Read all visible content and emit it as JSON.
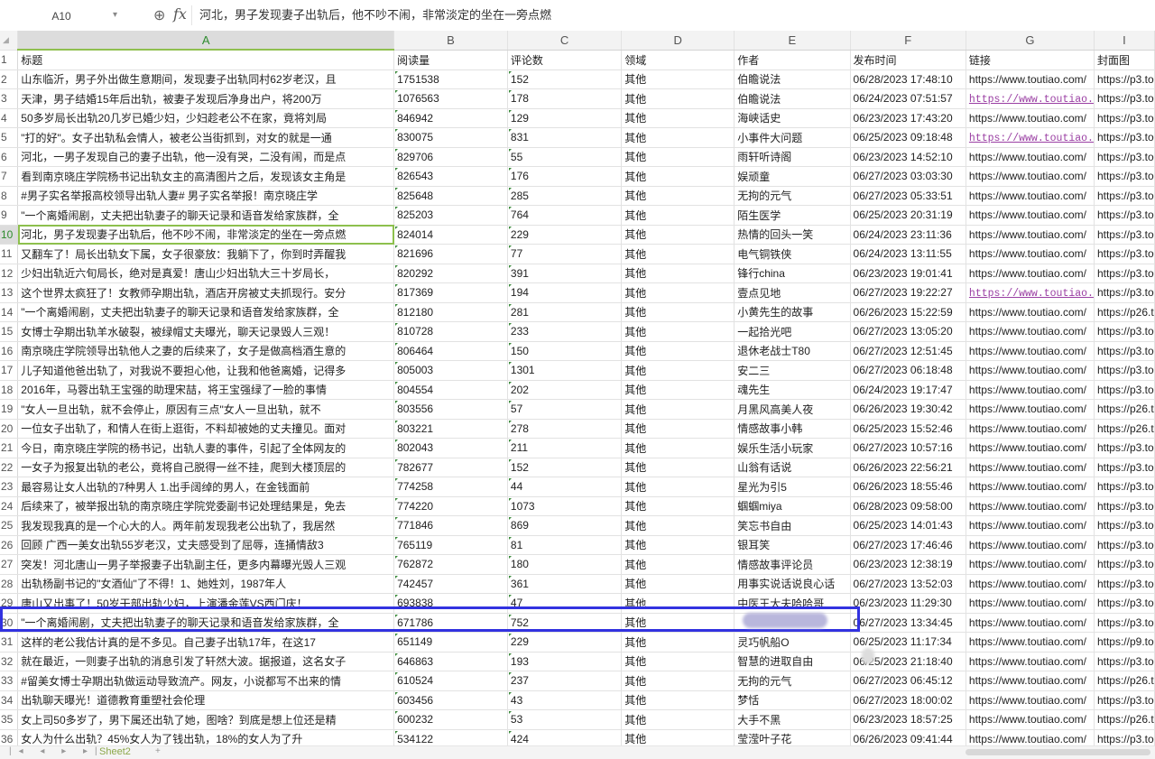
{
  "formula_bar": {
    "cell_ref": "A10",
    "fx_label": "fx",
    "content": "河北，男子发现妻子出轨后，他不吵不闹，非常淡定的坐在一旁点燃"
  },
  "columns": [
    "A",
    "B",
    "C",
    "D",
    "E",
    "F",
    "G",
    "I"
  ],
  "header_row": [
    "标题",
    "阅读量",
    "评论数",
    "领域",
    "作者",
    "发布时间",
    "链接",
    "封面图"
  ],
  "rows": [
    {
      "n": "2",
      "title": "山东临沂，男子外出做生意期间，发现妻子出轨同村62岁老汉，且",
      "reads": "1751538",
      "comments": "152",
      "domain": "其他",
      "author": "伯瞻说法",
      "time": "06/28/2023 17:48:10",
      "link": "https://www.toutiao.com/",
      "link_style": "plain",
      "cover": "https://p3.to"
    },
    {
      "n": "3",
      "title": "天津，男子结婚15年后出轨，被妻子发现后净身出户，将200万",
      "reads": "1076563",
      "comments": "178",
      "domain": "其他",
      "author": "伯瞻说法",
      "time": "06/24/2023 07:51:57",
      "link": "https://www.toutiao.",
      "link_style": "hyperlink",
      "cover": "https://p3.to"
    },
    {
      "n": "4",
      "title": "50多岁局长出轨20几岁已婚少妇，少妇趁老公不在家，竟将刘局",
      "reads": "846942",
      "comments": "129",
      "domain": "其他",
      "author": "海峡话史",
      "time": "06/23/2023 17:43:20",
      "link": "https://www.toutiao.com/",
      "link_style": "plain",
      "cover": "https://p3.to"
    },
    {
      "n": "5",
      "title": "\"打的好\"。女子出轨私会情人，被老公当街抓到，对女的就是一通",
      "reads": "830075",
      "comments": "831",
      "domain": "其他",
      "author": "小事件大问题",
      "time": "06/25/2023 09:18:48",
      "link": "https://www.toutiao.",
      "link_style": "hyperlink",
      "cover": "https://p3.to"
    },
    {
      "n": "6",
      "title": "河北，一男子发现自己的妻子出轨，他一没有哭，二没有闹，而是点",
      "reads": "829706",
      "comments": "55",
      "domain": "其他",
      "author": "雨轩听诗阁",
      "time": "06/23/2023 14:52:10",
      "link": "https://www.toutiao.com/",
      "link_style": "plain",
      "cover": "https://p3.to"
    },
    {
      "n": "7",
      "title": "看到南京晓庄学院杨书记出轨女主的高清图片之后，发现该女主角是",
      "reads": "826543",
      "comments": "176",
      "domain": "其他",
      "author": "娱顽童",
      "time": "06/27/2023 03:03:30",
      "link": "https://www.toutiao.com/",
      "link_style": "plain",
      "cover": "https://p3.to"
    },
    {
      "n": "8",
      "title": "#男子实名举报高校领导出轨人妻# 男子实名举报！南京晓庄学",
      "reads": "825648",
      "comments": "285",
      "domain": "其他",
      "author": "无拘的元气",
      "time": "06/27/2023 05:33:51",
      "link": "https://www.toutiao.com/",
      "link_style": "plain",
      "cover": "https://p3.to"
    },
    {
      "n": "9",
      "title": "\"一个离婚闹剧，丈夫把出轨妻子的聊天记录和语音发给家族群，全",
      "reads": "825203",
      "comments": "764",
      "domain": "其他",
      "author": "陌生医学",
      "time": "06/25/2023 20:31:19",
      "link": "https://www.toutiao.com/",
      "link_style": "plain",
      "cover": "https://p3.to"
    },
    {
      "n": "10",
      "title": "河北，男子发现妻子出轨后，他不吵不闹，非常淡定的坐在一旁点燃",
      "reads": "824014",
      "comments": "229",
      "domain": "其他",
      "author": "热情的回头一笑",
      "time": "06/24/2023 23:11:36",
      "link": "https://www.toutiao.com/",
      "link_style": "plain",
      "cover": "https://p3.to",
      "selected": true
    },
    {
      "n": "11",
      "title": "又翻车了！局长出轨女下属，女子很豪放：我躺下了，你到时弄醒我",
      "reads": "821696",
      "comments": "77",
      "domain": "其他",
      "author": "电气铜铁侠",
      "time": "06/24/2023 13:11:55",
      "link": "https://www.toutiao.com/",
      "link_style": "plain",
      "cover": "https://p3.to"
    },
    {
      "n": "12",
      "title": "少妇出轨近六旬局长，绝对是真爱！唐山少妇出轨大三十岁局长，",
      "reads": "820292",
      "comments": "391",
      "domain": "其他",
      "author": "锋行china",
      "time": "06/23/2023 19:01:41",
      "link": "https://www.toutiao.com/",
      "link_style": "plain",
      "cover": "https://p3.to"
    },
    {
      "n": "13",
      "title": "这个世界太疯狂了！女教师孕期出轨，酒店开房被丈夫抓现行。安分",
      "reads": "817369",
      "comments": "194",
      "domain": "其他",
      "author": "壹点见地",
      "time": "06/27/2023 19:22:27",
      "link": "https://www.toutiao.",
      "link_style": "hyperlink",
      "cover": "https://p3.to"
    },
    {
      "n": "14",
      "title": "\"一个离婚闹剧，丈夫把出轨妻子的聊天记录和语音发给家族群，全",
      "reads": "812180",
      "comments": "281",
      "domain": "其他",
      "author": "小黄先生的故事",
      "time": "06/26/2023 15:22:59",
      "link": "https://www.toutiao.com/",
      "link_style": "plain",
      "cover": "https://p26.t"
    },
    {
      "n": "15",
      "title": "女博士孕期出轨羊水破裂，被绿帽丈夫曝光，聊天记录毁人三观！",
      "reads": "810728",
      "comments": "233",
      "domain": "其他",
      "author": "一起拾光吧",
      "time": "06/27/2023 13:05:20",
      "link": "https://www.toutiao.com/",
      "link_style": "plain",
      "cover": "https://p3.to"
    },
    {
      "n": "16",
      "title": "南京晓庄学院领导出轨他人之妻的后续来了，女子是做高档酒生意的",
      "reads": "806464",
      "comments": "150",
      "domain": "其他",
      "author": "退休老战士T80",
      "time": "06/27/2023 12:51:45",
      "link": "https://www.toutiao.com/",
      "link_style": "plain",
      "cover": "https://p3.to"
    },
    {
      "n": "17",
      "title": "儿子知道他爸出轨了，对我说不要担心他，让我和他爸离婚，记得多",
      "reads": "805003",
      "comments": "1301",
      "domain": "其他",
      "author": "安二三",
      "time": "06/27/2023 06:18:48",
      "link": "https://www.toutiao.com/",
      "link_style": "plain",
      "cover": "https://p3.to"
    },
    {
      "n": "18",
      "title": "2016年，马蓉出轨王宝强的助理宋喆，将王宝强绿了一脸的事情",
      "reads": "804554",
      "comments": "202",
      "domain": "其他",
      "author": "魂先生",
      "time": "06/24/2023 19:17:47",
      "link": "https://www.toutiao.com/",
      "link_style": "plain",
      "cover": "https://p3.to"
    },
    {
      "n": "19",
      "title": "\"女人一旦出轨，就不会停止，原因有三点\"女人一旦出轨，就不",
      "reads": "803556",
      "comments": "57",
      "domain": "其他",
      "author": "月黑风高美人夜",
      "time": "06/26/2023 19:30:42",
      "link": "https://www.toutiao.com/",
      "link_style": "plain",
      "cover": "https://p26.t"
    },
    {
      "n": "20",
      "title": "一位女子出轨了，和情人在街上逛街，不料却被她的丈夫撞见。面对",
      "reads": "803221",
      "comments": "278",
      "domain": "其他",
      "author": "情感故事小韩",
      "time": "06/25/2023 15:52:46",
      "link": "https://www.toutiao.com/",
      "link_style": "plain",
      "cover": "https://p26.t"
    },
    {
      "n": "21",
      "title": "今日，南京晓庄学院的杨书记，出轨人妻的事件，引起了全体网友的",
      "reads": "802043",
      "comments": "211",
      "domain": "其他",
      "author": "娱乐生活小玩家",
      "time": "06/27/2023 10:57:16",
      "link": "https://www.toutiao.com/",
      "link_style": "plain",
      "cover": "https://p3.to"
    },
    {
      "n": "22",
      "title": "一女子为报复出轨的老公，竟将自己脱得一丝不挂，爬到大楼顶层的",
      "reads": "782677",
      "comments": "152",
      "domain": "其他",
      "author": "山翁有话说",
      "time": "06/26/2023 22:56:21",
      "link": "https://www.toutiao.com/",
      "link_style": "plain",
      "cover": "https://p3.to"
    },
    {
      "n": "23",
      "title": "最容易让女人出轨的7种男人 1.出手阔绰的男人，在金钱面前",
      "reads": "774258",
      "comments": "44",
      "domain": "其他",
      "author": "星光为引5",
      "time": "06/26/2023 18:55:46",
      "link": "https://www.toutiao.com/",
      "link_style": "plain",
      "cover": "https://p3.to"
    },
    {
      "n": "24",
      "title": "后续来了，被举报出轨的南京晓庄学院党委副书记处理结果是，免去",
      "reads": "774220",
      "comments": "1073",
      "domain": "其他",
      "author": "蝈蝈miya",
      "time": "06/28/2023 09:58:00",
      "link": "https://www.toutiao.com/",
      "link_style": "plain",
      "cover": "https://p3.to"
    },
    {
      "n": "25",
      "title": "我发现我真的是一个心大的人。两年前发现我老公出轨了，我居然",
      "reads": "771846",
      "comments": "869",
      "domain": "其他",
      "author": "笑忘书自由",
      "time": "06/25/2023 14:01:43",
      "link": "https://www.toutiao.com/",
      "link_style": "plain",
      "cover": "https://p3.to"
    },
    {
      "n": "26",
      "title": "回顾 广西一美女出轨55岁老汉，丈夫感受到了屈辱，连捅情敌3",
      "reads": "765119",
      "comments": "81",
      "domain": "其他",
      "author": "银耳笑",
      "time": "06/27/2023 17:46:46",
      "link": "https://www.toutiao.com/",
      "link_style": "plain",
      "cover": "https://p3.to"
    },
    {
      "n": "27",
      "title": "突发！河北唐山一男子举报妻子出轨副主任，更多内幕曝光毁人三观",
      "reads": "762872",
      "comments": "180",
      "domain": "其他",
      "author": "情感故事评论员",
      "time": "06/23/2023 12:38:19",
      "link": "https://www.toutiao.com/",
      "link_style": "plain",
      "cover": "https://p3.to"
    },
    {
      "n": "28",
      "title": "出轨杨副书记的\"女酒仙\"了不得！1、她姓刘，1987年人",
      "reads": "742457",
      "comments": "361",
      "domain": "其他",
      "author": "用事实说话说良心话",
      "time": "06/27/2023 13:52:03",
      "link": "https://www.toutiao.com/",
      "link_style": "plain",
      "cover": "https://p3.to"
    },
    {
      "n": "29",
      "title": "唐山又出事了！50岁干部出轨少妇，上演潘金莲VS西门庆！",
      "reads": "693838",
      "comments": "47",
      "domain": "其他",
      "author": "中医王大夫哈哈哥",
      "time": "06/23/2023 11:29:30",
      "link": "https://www.toutiao.com/",
      "link_style": "plain",
      "cover": "https://p3.to"
    },
    {
      "n": "30",
      "title": "\"一个离婚闹剧，丈夫把出轨妻子的聊天记录和语音发给家族群，全",
      "reads": "671786",
      "comments": "752",
      "domain": "其他",
      "author": "",
      "time": "06/27/2023 13:34:45",
      "link": "https://www.toutiao.com/",
      "link_style": "plain",
      "cover": "https://p3.to",
      "highlighted": true
    },
    {
      "n": "31",
      "title": "这样的老公我估计真的是不多见。自己妻子出轨17年，在这17",
      "reads": "651149",
      "comments": "229",
      "domain": "其他",
      "author": "灵巧帆船O",
      "time": "06/25/2023 11:17:34",
      "link": "https://www.toutiao.com/",
      "link_style": "plain",
      "cover": "https://p9.to"
    },
    {
      "n": "32",
      "title": "就在最近，一则妻子出轨的消息引发了轩然大波。据报道，这名女子",
      "reads": "646863",
      "comments": "193",
      "domain": "其他",
      "author": "智慧的进取自由",
      "time": "06/25/2023 21:18:40",
      "link": "https://www.toutiao.com/",
      "link_style": "plain",
      "cover": "https://p3.to"
    },
    {
      "n": "33",
      "title": "#留美女博士孕期出轨做运动导致流产。网友，小说都写不出来的情",
      "reads": "610524",
      "comments": "237",
      "domain": "其他",
      "author": "无拘的元气",
      "time": "06/27/2023 06:45:12",
      "link": "https://www.toutiao.com/",
      "link_style": "plain",
      "cover": "https://p26.t"
    },
    {
      "n": "34",
      "title": "出轨聊天曝光！道德教育重塑社会伦理",
      "reads": "603456",
      "comments": "43",
      "domain": "其他",
      "author": "梦恬",
      "time": "06/27/2023 18:00:02",
      "link": "https://www.toutiao.com/",
      "link_style": "plain",
      "cover": "https://p3.to"
    },
    {
      "n": "35",
      "title": "女上司50多岁了，男下属还出轨了她，图啥？到底是想上位还是精",
      "reads": "600232",
      "comments": "53",
      "domain": "其他",
      "author": "大手不黑",
      "time": "06/23/2023 18:57:25",
      "link": "https://www.toutiao.com/",
      "link_style": "plain",
      "cover": "https://p26.t"
    },
    {
      "n": "36",
      "title": "女人为什么出轨？45%女人为了钱出轨，18%的女人为了升",
      "reads": "534122",
      "comments": "424",
      "domain": "其他",
      "author": "莹滢叶子花",
      "time": "06/26/2023 09:41:44",
      "link": "https://www.toutiao.com/",
      "link_style": "plain",
      "cover": "https://p3.to"
    }
  ],
  "bottom": {
    "sheet_nav": "|◂ ◂ ▸ ▸|",
    "sheet_tab": "Sheet2",
    "add_tab": "+"
  }
}
